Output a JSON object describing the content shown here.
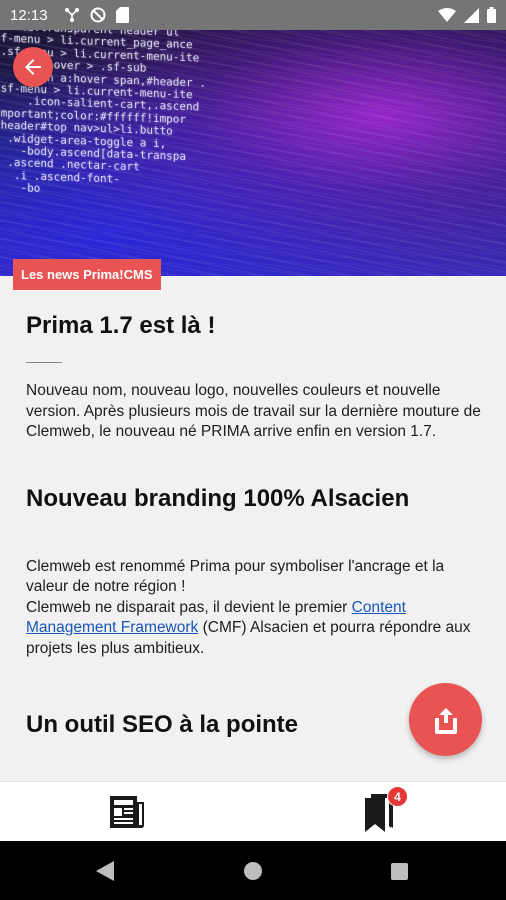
{
  "status_bar": {
    "time": "12:13",
    "icons_left": [
      "connected-icon",
      "data-saver-icon",
      "sim-card-icon"
    ],
    "icons_right": [
      "wifi-icon",
      "signal-icon",
      "battery-icon"
    ]
  },
  "hero": {
    "code_lines": [
      "gul>li.transparent header ul",
      "sf-menu > li.current_page_ance",
      " .sf-menu > li.current-menu-ite",
      "     li:hover > .sf-sub",
      "     .btn a:hover span,#header .",
      " sf-menu > li.current-menu-ite",
      "     .icon-salient-cart,.ascend",
      "important;color:#ffffff!impor",
      " header#top nav>ul>li.butto",
      "  .widget-area-toggle a i,",
      "    -body.ascend[data-transpa",
      "  .ascend .nectar-cart",
      "   .i .ascend-font-",
      "    -bo",
      "",
      "",
      ""
    ]
  },
  "category_tag": "Les news Prima!CMS",
  "article": {
    "title": "Prima 1.7 est là !",
    "intro": "Nouveau nom, nouveau logo, nouvelles couleurs et nouvelle version. Après plusieurs mois de travail sur la dernière mouture de Clemweb, le nouveau né PRIMA arrive enfin en version 1.7.",
    "section1_heading": "Nouveau branding 100% Alsacien",
    "section1_p1": "Clemweb est renommé Prima pour symboliser l'ancrage et la valeur de notre région !",
    "section1_p2_before": "Clemweb ne disparait pas, il devient le premier ",
    "section1_link": "Content Management Framework",
    "section1_p2_after": " (CMF) Alsacien et pourra répondre aux projets les plus ambitieux.",
    "section2_heading": "Un outil SEO à la pointe"
  },
  "bottom_nav": {
    "bookmarks_badge": "4"
  },
  "colors": {
    "accent": "#e95353",
    "link": "#1a57b8",
    "status_bar": "#757575"
  }
}
